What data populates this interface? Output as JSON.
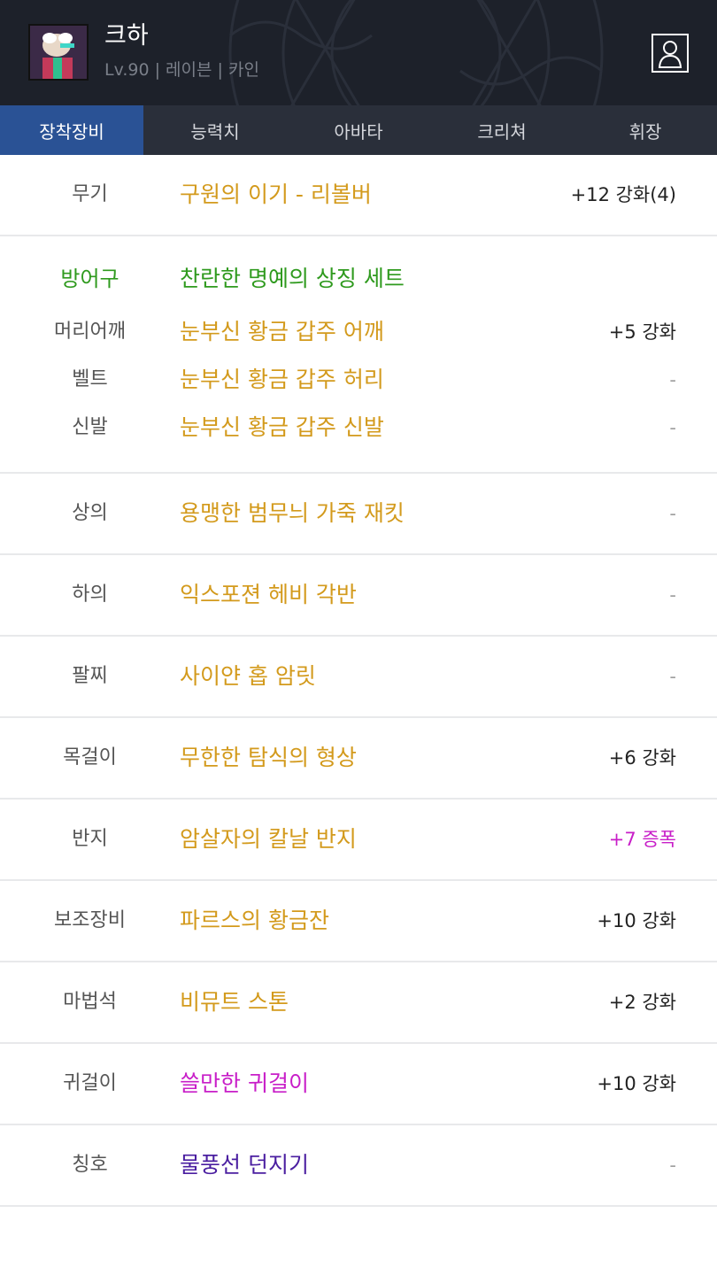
{
  "header": {
    "name": "크하",
    "info": "Lv.90 | 레이븐 | 카인",
    "profile_icon": "user-profile-icon"
  },
  "tabs": [
    {
      "label": "장착장비",
      "active": true
    },
    {
      "label": "능력치",
      "active": false
    },
    {
      "label": "아바타",
      "active": false
    },
    {
      "label": "크리쳐",
      "active": false
    },
    {
      "label": "휘장",
      "active": false
    }
  ],
  "colors": {
    "unique": "#d39a1c",
    "set": "#2f9a1e",
    "legendary_epic": "#c81ec8",
    "title": "#4a1ea0",
    "amplify": "#c81ec8",
    "enhance": "#222222"
  },
  "equipment": {
    "weapon": {
      "category": "무기",
      "item": "구원의 이기 - 리볼버",
      "enhance": "+12 강화(4)"
    },
    "armor_set": {
      "category": "방어구",
      "set_name": "찬란한 명예의 상징 세트",
      "items": [
        {
          "category": "머리어깨",
          "item": "눈부신 황금 갑주 어깨",
          "enhance": "+5 강화"
        },
        {
          "category": "벨트",
          "item": "눈부신 황금 갑주 허리",
          "enhance": "-"
        },
        {
          "category": "신발",
          "item": "눈부신 황금 갑주 신발",
          "enhance": "-"
        }
      ]
    },
    "others": [
      {
        "category": "상의",
        "item": "용맹한 범무늬 가죽 재킷",
        "enhance": "-"
      },
      {
        "category": "하의",
        "item": "익스포젼 헤비 각반",
        "enhance": "-"
      },
      {
        "category": "팔찌",
        "item": "사이얀 홉 암릿",
        "enhance": "-"
      },
      {
        "category": "목걸이",
        "item": "무한한 탐식의 형상",
        "enhance": "+6 강화"
      },
      {
        "category": "반지",
        "item": "암살자의 칼날 반지",
        "enhance": "+7 증폭"
      },
      {
        "category": "보조장비",
        "item": "파르스의 황금잔",
        "enhance": "+10 강화"
      },
      {
        "category": "마법석",
        "item": "비뮤트 스톤",
        "enhance": "+2 강화"
      },
      {
        "category": "귀걸이",
        "item": "쓸만한 귀걸이",
        "enhance": "+10 강화"
      },
      {
        "category": "칭호",
        "item": "물풍선 던지기",
        "enhance": "-"
      }
    ]
  }
}
